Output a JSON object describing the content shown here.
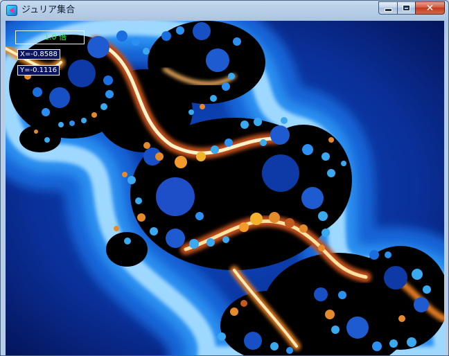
{
  "window": {
    "title": "ジュリア集合",
    "app_icon": "julia-app-icon",
    "controls": {
      "minimize": "minimize-icon",
      "maximize": "maximize-icon",
      "close": "✕"
    }
  },
  "overlay": {
    "frame_label": "1.0 倍",
    "x_readout": "X=-0.8588",
    "y_readout": "Y=-0.1116"
  },
  "colors": {
    "background_deep": "#03104f",
    "background_mid": "#0a3ba8",
    "halo": "#bfe6ff",
    "interior": "#000000",
    "glow_orange": "#f39a2c",
    "glow_cream": "#fff2c8",
    "bulb_blue": "#1e5bd0",
    "bulb_light": "#3aa9f0"
  }
}
